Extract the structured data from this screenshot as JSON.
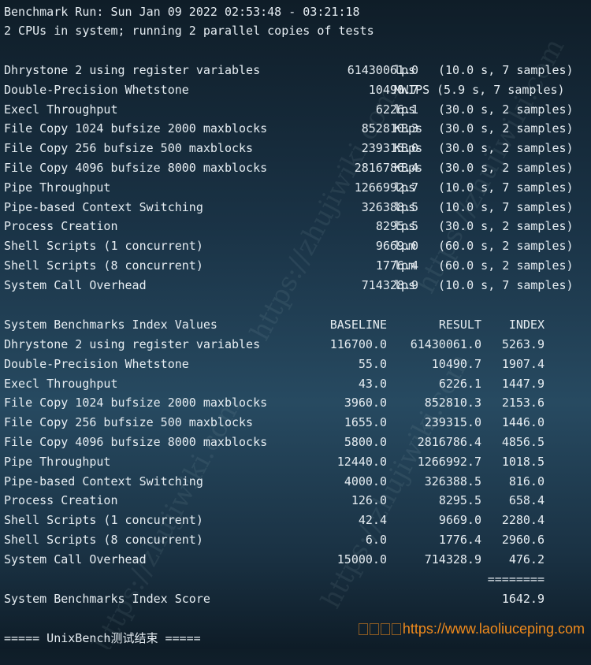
{
  "header": {
    "run_line": "Benchmark Run: Sun Jan 09 2022 02:53:48 - 03:21:18",
    "cpu_line": "2 CPUs in system; running 2 parallel copies of tests"
  },
  "tests": [
    {
      "name": "Dhrystone 2 using register variables",
      "value": "61430061.0",
      "unit": "lps",
      "detail": "(10.0 s, 7 samples)"
    },
    {
      "name": "Double-Precision Whetstone",
      "value": "10490.7",
      "unit": "MWIPS",
      "detail": "(5.9 s, 7 samples)"
    },
    {
      "name": "Execl Throughput",
      "value": "6226.1",
      "unit": "lps",
      "detail": "(30.0 s, 2 samples)"
    },
    {
      "name": "File Copy 1024 bufsize 2000 maxblocks",
      "value": "852810.3",
      "unit": "KBps",
      "detail": "(30.0 s, 2 samples)"
    },
    {
      "name": "File Copy 256 bufsize 500 maxblocks",
      "value": "239315.0",
      "unit": "KBps",
      "detail": "(30.0 s, 2 samples)"
    },
    {
      "name": "File Copy 4096 bufsize 8000 maxblocks",
      "value": "2816786.4",
      "unit": "KBps",
      "detail": "(30.0 s, 2 samples)"
    },
    {
      "name": "Pipe Throughput",
      "value": "1266992.7",
      "unit": "lps",
      "detail": "(10.0 s, 7 samples)"
    },
    {
      "name": "Pipe-based Context Switching",
      "value": "326388.5",
      "unit": "lps",
      "detail": "(10.0 s, 7 samples)"
    },
    {
      "name": "Process Creation",
      "value": "8295.5",
      "unit": "lps",
      "detail": "(30.0 s, 2 samples)"
    },
    {
      "name": "Shell Scripts (1 concurrent)",
      "value": "9669.0",
      "unit": "lpm",
      "detail": "(60.0 s, 2 samples)"
    },
    {
      "name": "Shell Scripts (8 concurrent)",
      "value": "1776.4",
      "unit": "lpm",
      "detail": "(60.0 s, 2 samples)"
    },
    {
      "name": "System Call Overhead",
      "value": "714328.9",
      "unit": "lps",
      "detail": "(10.0 s, 7 samples)"
    }
  ],
  "index_table": {
    "title": "System Benchmarks Index Values",
    "headers": [
      "BASELINE",
      "RESULT",
      "INDEX"
    ],
    "rows": [
      {
        "name": "Dhrystone 2 using register variables",
        "baseline": "116700.0",
        "result": "61430061.0",
        "index": "5263.9"
      },
      {
        "name": "Double-Precision Whetstone",
        "baseline": "55.0",
        "result": "10490.7",
        "index": "1907.4"
      },
      {
        "name": "Execl Throughput",
        "baseline": "43.0",
        "result": "6226.1",
        "index": "1447.9"
      },
      {
        "name": "File Copy 1024 bufsize 2000 maxblocks",
        "baseline": "3960.0",
        "result": "852810.3",
        "index": "2153.6"
      },
      {
        "name": "File Copy 256 bufsize 500 maxblocks",
        "baseline": "1655.0",
        "result": "239315.0",
        "index": "1446.0"
      },
      {
        "name": "File Copy 4096 bufsize 8000 maxblocks",
        "baseline": "5800.0",
        "result": "2816786.4",
        "index": "4856.5"
      },
      {
        "name": "Pipe Throughput",
        "baseline": "12440.0",
        "result": "1266992.7",
        "index": "1018.5"
      },
      {
        "name": "Pipe-based Context Switching",
        "baseline": "4000.0",
        "result": "326388.5",
        "index": "816.0"
      },
      {
        "name": "Process Creation",
        "baseline": "126.0",
        "result": "8295.5",
        "index": "658.4"
      },
      {
        "name": "Shell Scripts (1 concurrent)",
        "baseline": "42.4",
        "result": "9669.0",
        "index": "2280.4"
      },
      {
        "name": "Shell Scripts (8 concurrent)",
        "baseline": "6.0",
        "result": "1776.4",
        "index": "2960.6"
      },
      {
        "name": "System Call Overhead",
        "baseline": "15000.0",
        "result": "714328.9",
        "index": "476.2"
      }
    ],
    "separator": "========",
    "score_label": "System Benchmarks Index Score",
    "score_value": "1642.9"
  },
  "footer": {
    "end_line": "===== UnixBench测试结束 =====",
    "site": "https://www.laoliuceping.com"
  },
  "watermark": {
    "text": "https://zhujiwiki.com"
  }
}
